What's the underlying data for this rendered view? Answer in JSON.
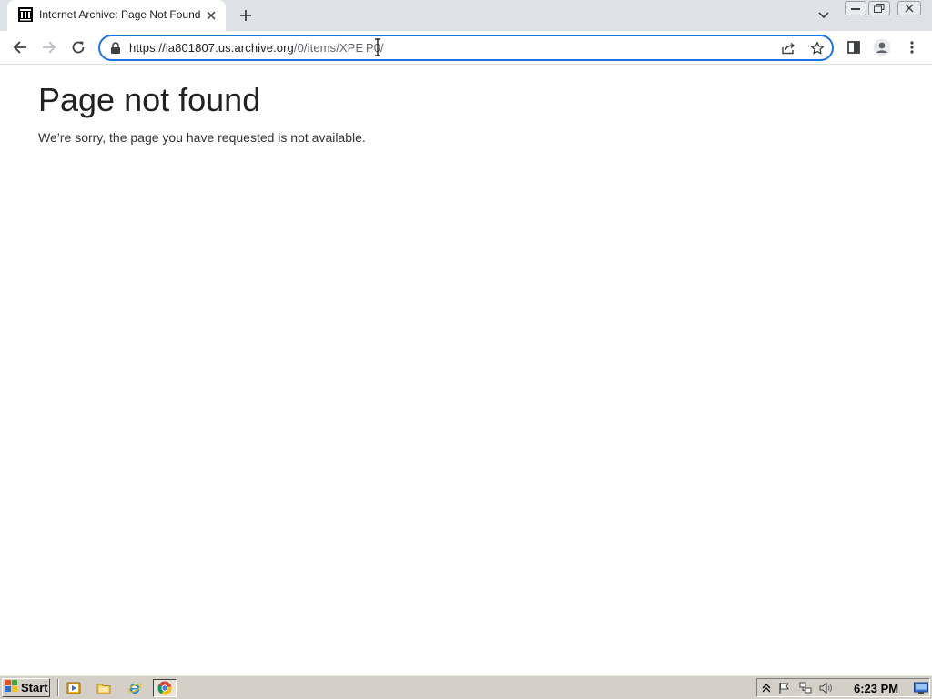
{
  "browser": {
    "tab": {
      "title": "Internet Archive: Page Not Found"
    },
    "address": {
      "host": "https://ia801807.us.archive.org",
      "path": "/0/items/XPE P0/"
    }
  },
  "page": {
    "title": "Page not found",
    "message": "We’re sorry, the page you have requested is not available."
  },
  "taskbar": {
    "start_label": "Start",
    "clock": "6:23 PM"
  },
  "icons": {
    "tab_favicon": "archive-building-icon",
    "accent": "#1a73e8",
    "tab_strip_bg": "#dee1e6",
    "taskbar_bg": "#d4d0c8"
  }
}
